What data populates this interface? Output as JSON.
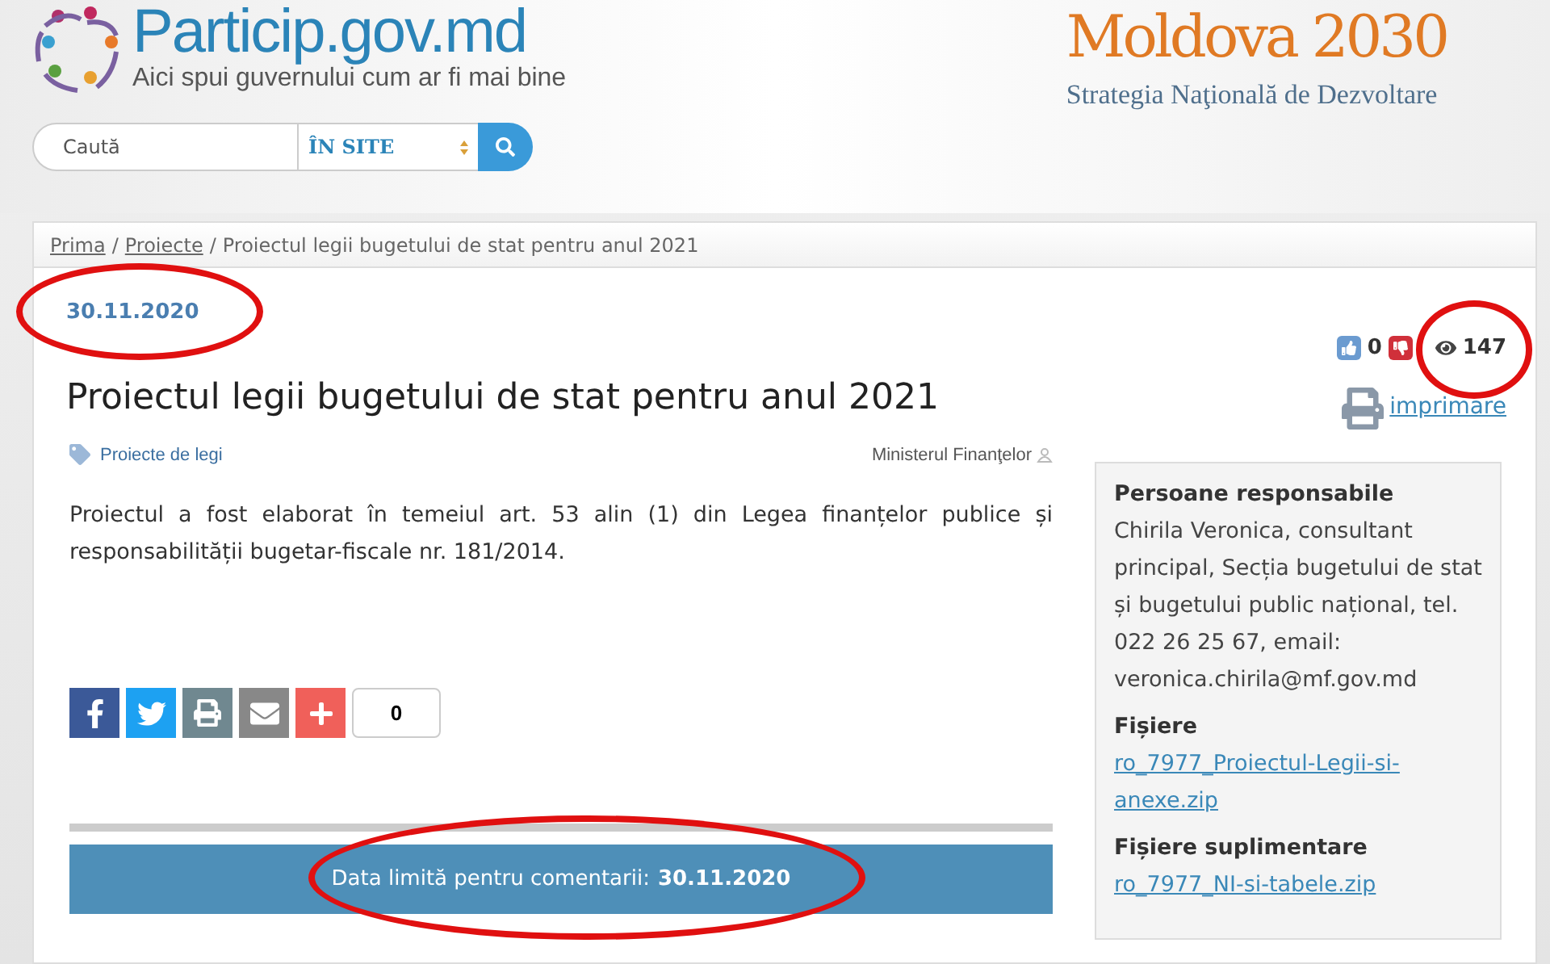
{
  "header": {
    "site_name": "Particip.gov.md",
    "tagline": "Aici spui guvernului cum ar fi mai bine",
    "search": {
      "placeholder": "Caută",
      "scope": "ÎN SITE"
    },
    "banner_title": "Moldova 2030",
    "banner_subtitle": "Strategia Naţională de Dezvoltare"
  },
  "breadcrumb": [
    {
      "label": "Prima",
      "kind": "link"
    },
    {
      "label": "Proiecte",
      "kind": "link",
      "separator": "/"
    },
    {
      "label": "Proiectul legii bugetului de stat pentru anul 2021",
      "kind": "current",
      "separator": "/"
    }
  ],
  "date": {
    "text": "30.11.2020",
    "highlighted": true
  },
  "stats": {
    "likes": "0",
    "views": "147",
    "views_highlighted": true
  },
  "title": "Proiectul legii bugetului de stat pentru anul 2021",
  "print_link": "imprimare",
  "category": "Proiecte de legi",
  "author": "Ministerul Finanţelor",
  "body": "Proiectul a fost elaborat în temeiul art. 53 alin (1) din Legea finanțelor publice și responsabilității bugetar-fiscale nr. 181/2014.",
  "share_count": "0",
  "deadline": {
    "label": "Data limită pentru comentarii:",
    "date": "30.11.2020",
    "highlighted": true
  },
  "sidebar": [
    {
      "heading": "Persoane responsabile",
      "kind": "text",
      "text": "Chirila Veronica, consultant principal, Secția bugetului de stat și bugetului public național, tel. 022 26 25 67, email: veronica.chirila@mf.gov.md"
    },
    {
      "heading": "Fișiere",
      "kind": "link",
      "text": "ro_7977_Proiectul-Legii-si-anexe.zip"
    },
    {
      "heading": "Fișiere suplimentare",
      "kind": "link",
      "text": "ro_7977_NI-si-tabele.zip"
    }
  ]
}
